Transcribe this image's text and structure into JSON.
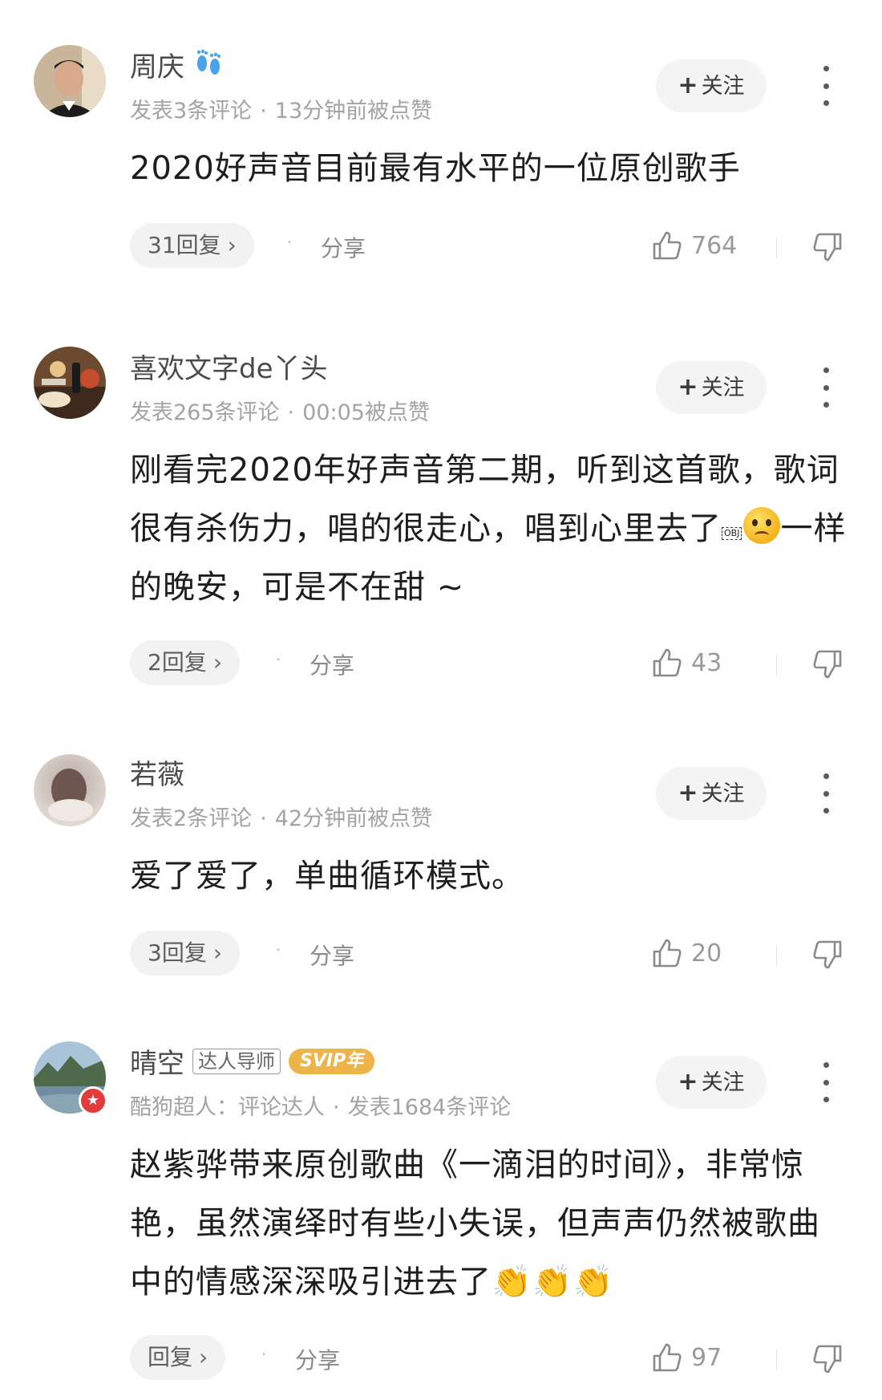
{
  "comments": [
    {
      "username": "周庆",
      "username_suffix_icon": "footprints-icon",
      "meta": [
        "发表3条评论",
        "13分钟前被点赞"
      ],
      "follow_label": "关注",
      "content": "2020好声音目前最有水平的一位原创歌手",
      "reply_label": "31回复",
      "share_label": "分享",
      "like_count": "764"
    },
    {
      "username": "喜欢文字de丫头",
      "meta": [
        "发表265条评论",
        "00:05被点赞"
      ],
      "follow_label": "关注",
      "content_parts": [
        "刚看完2020年好声音第二期，听到这首歌，歌词很有杀伤力，唱的很走心，唱到心里去了",
        "OBJ",
        "一样的晚安，可是不在甜 ~"
      ],
      "content_emoji": "sad-face-emoji",
      "reply_label": "2回复",
      "share_label": "分享",
      "like_count": "43"
    },
    {
      "username": "若薇",
      "meta": [
        "发表2条评论",
        "42分钟前被点赞"
      ],
      "follow_label": "关注",
      "content": "爱了爱了，单曲循环模式。",
      "reply_label": "3回复",
      "share_label": "分享",
      "like_count": "20"
    },
    {
      "username": "晴空",
      "badge_tag": "达人导师",
      "badge_svip": "SVIP年",
      "meta": [
        "酷狗超人：评论达人",
        "发表1684条评论"
      ],
      "follow_label": "关注",
      "content": "赵紫骅带来原创歌曲《一滴泪的时间》，非常惊艳，虽然演绎时有些小失误，但声声仍然被歌曲中的情感深深吸引进去了",
      "content_emoji": "clapping-hands-emoji",
      "reply_label": "回复",
      "share_label": "分享",
      "like_count": "97"
    }
  ],
  "colors": {
    "follow_bg": "#f4f4f4",
    "svip_gold": "#ecb54a",
    "vip_red": "#e23b3b"
  }
}
